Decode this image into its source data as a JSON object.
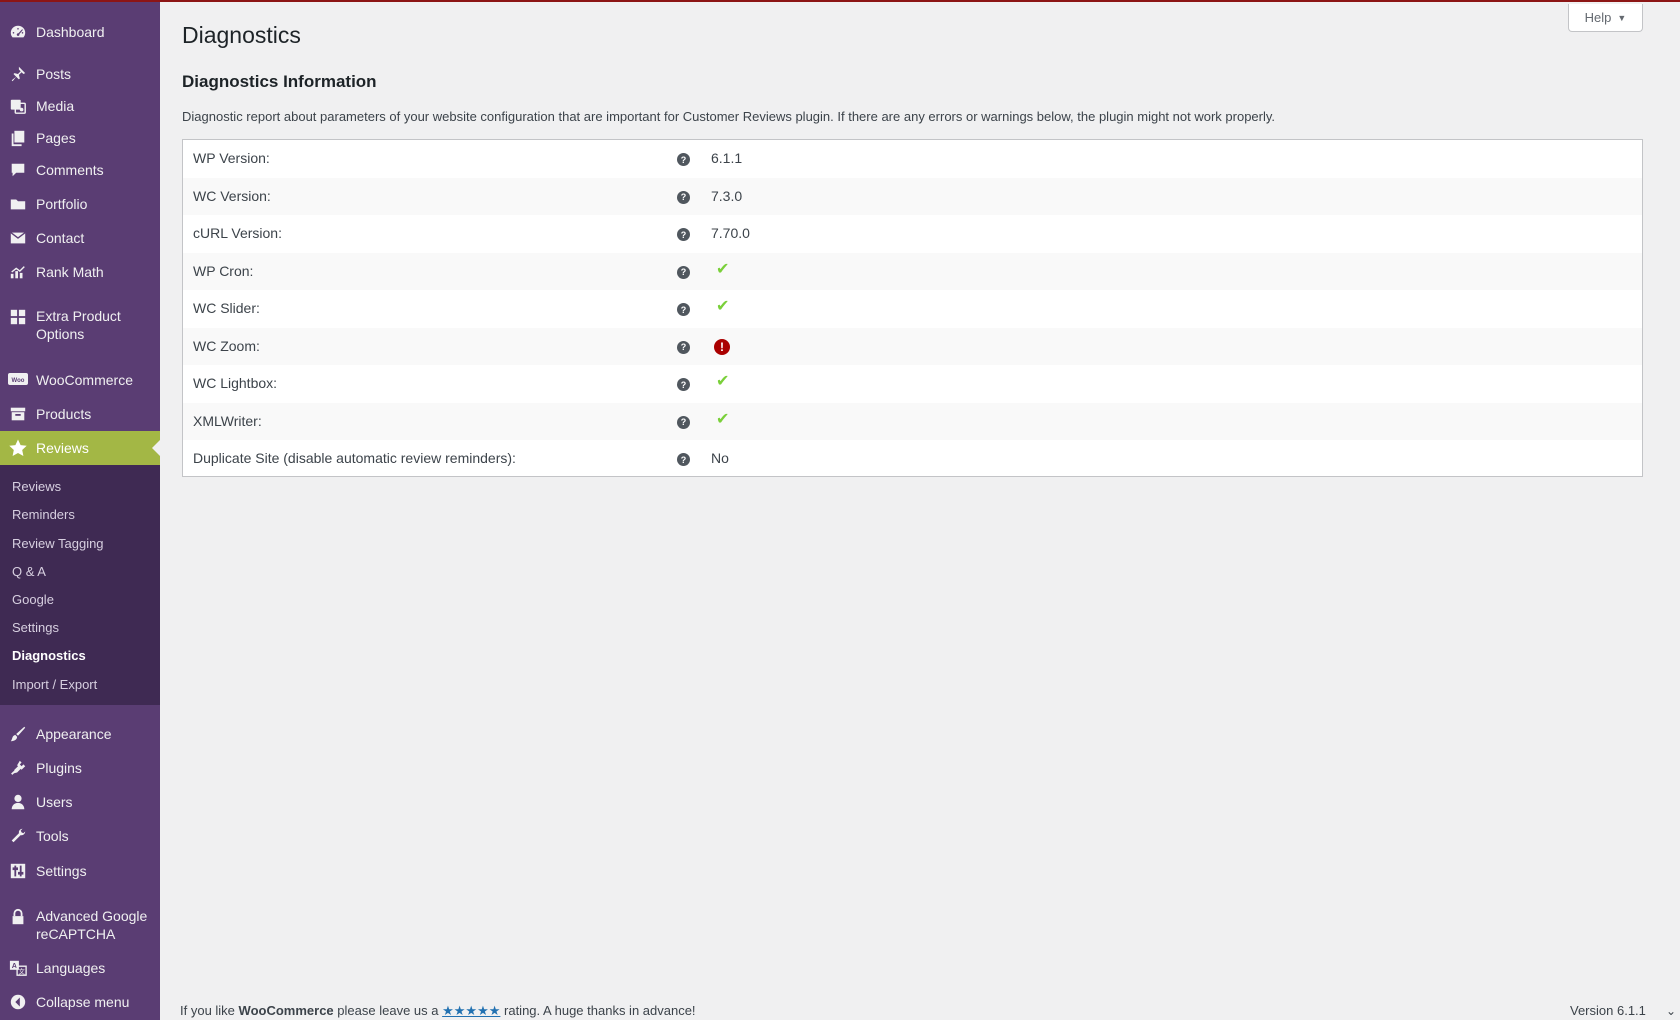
{
  "sidebar": {
    "items": [
      {
        "label": "Dashboard",
        "icon": "dashboard-icon"
      },
      {
        "label": "Posts",
        "icon": "pin-icon"
      },
      {
        "label": "Media",
        "icon": "media-icon"
      },
      {
        "label": "Pages",
        "icon": "pages-icon"
      },
      {
        "label": "Comments",
        "icon": "comment-icon"
      },
      {
        "label": "Portfolio",
        "icon": "folder-icon"
      },
      {
        "label": "Contact",
        "icon": "envelope-icon"
      },
      {
        "label": "Rank Math",
        "icon": "chart-icon"
      },
      {
        "label": "Extra Product Options",
        "icon": "grid-icon"
      },
      {
        "label": "WooCommerce",
        "icon": "woo-icon"
      },
      {
        "label": "Products",
        "icon": "archive-icon"
      },
      {
        "label": "Reviews",
        "icon": "star-icon"
      },
      {
        "label": "Appearance",
        "icon": "brush-icon"
      },
      {
        "label": "Plugins",
        "icon": "plug-icon"
      },
      {
        "label": "Users",
        "icon": "user-icon"
      },
      {
        "label": "Tools",
        "icon": "wrench-icon"
      },
      {
        "label": "Settings",
        "icon": "sliders-icon"
      },
      {
        "label": "Advanced Google reCAPTCHA",
        "icon": "lock-icon"
      },
      {
        "label": "Languages",
        "icon": "translate-icon"
      },
      {
        "label": "Collapse menu",
        "icon": "collapse-icon"
      }
    ],
    "submenu": [
      {
        "label": "Reviews"
      },
      {
        "label": "Reminders"
      },
      {
        "label": "Review Tagging"
      },
      {
        "label": "Q & A"
      },
      {
        "label": "Google"
      },
      {
        "label": "Settings"
      },
      {
        "label": "Diagnostics"
      },
      {
        "label": "Import / Export"
      }
    ]
  },
  "header": {
    "help_label": "Help",
    "page_title": "Diagnostics",
    "section_title": "Diagnostics Information",
    "description": "Diagnostic report about parameters of your website configuration that are important for Customer Reviews plugin. If there are any errors or warnings below, the plugin might not work properly."
  },
  "diagnostics": [
    {
      "label": "WP Version:",
      "value": "6.1.1",
      "status": "text"
    },
    {
      "label": "WC Version:",
      "value": "7.3.0",
      "status": "text"
    },
    {
      "label": "cURL Version:",
      "value": "7.70.0",
      "status": "text"
    },
    {
      "label": "WP Cron:",
      "value": "✔",
      "status": "ok"
    },
    {
      "label": "WC Slider:",
      "value": "✔",
      "status": "ok"
    },
    {
      "label": "WC Zoom:",
      "value": "!",
      "status": "error"
    },
    {
      "label": "WC Lightbox:",
      "value": "✔",
      "status": "ok"
    },
    {
      "label": "XMLWriter:",
      "value": "✔",
      "status": "ok"
    },
    {
      "label": "Duplicate Site (disable automatic review reminders):",
      "value": "No",
      "status": "text"
    }
  ],
  "footer": {
    "prefix": "If you like",
    "brand": "WooCommerce",
    "middle": "please leave us a",
    "stars": "★★★★★",
    "suffix": "rating. A huge thanks in advance!",
    "version": "Version 6.1.1"
  },
  "colors": {
    "sidebar_bg": "#5a3d73",
    "submenu_bg": "#3f2a53",
    "active_bg": "#a3b745",
    "ok": "#7ad03a",
    "error": "#aa0000",
    "link": "#2271b1"
  }
}
